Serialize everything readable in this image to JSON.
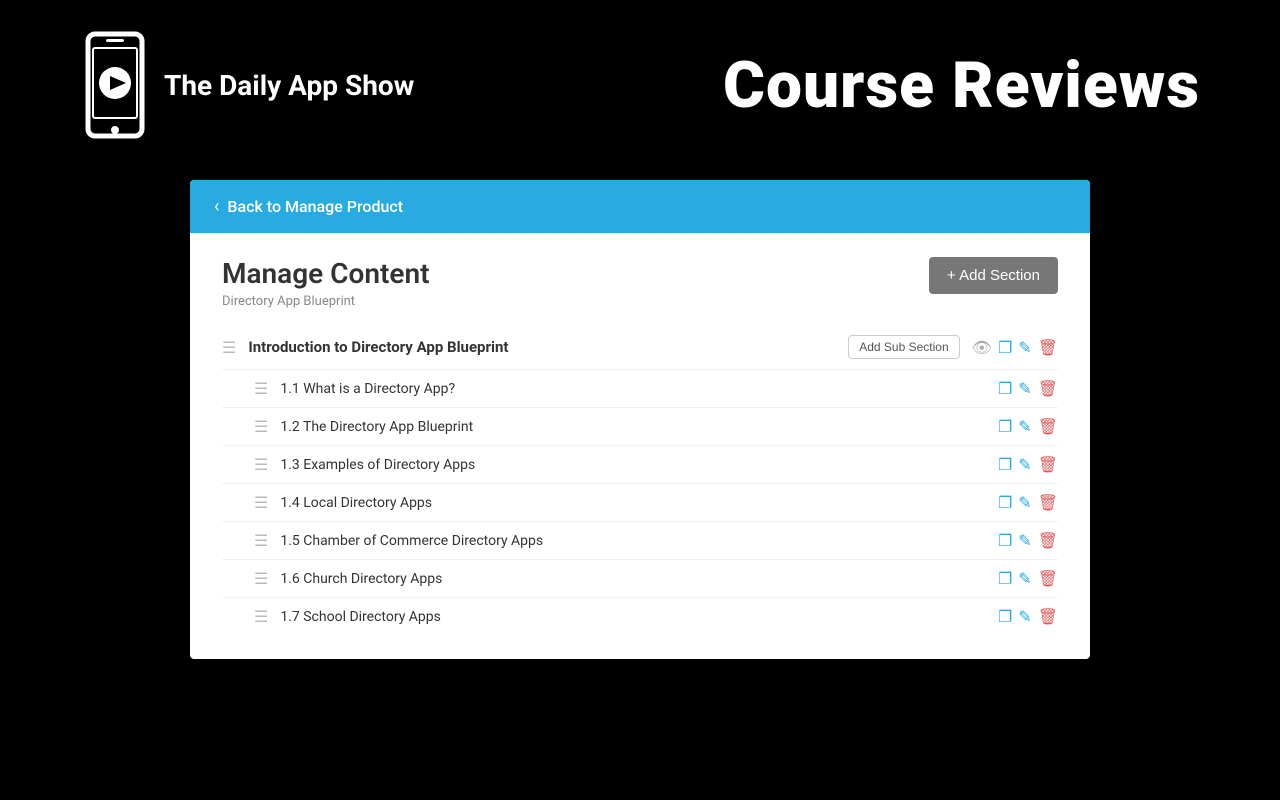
{
  "header": {
    "logo_text": "The Daily App Show",
    "page_title": "Course Reviews"
  },
  "back_nav": {
    "label": "Back to Manage Product"
  },
  "manage_content": {
    "title": "Manage Content",
    "subtitle": "Directory App Blueprint",
    "add_section_label": "+ Add Section"
  },
  "section": {
    "title": "Introduction to Directory App Blueprint",
    "add_sub_section_label": "Add Sub Section",
    "items": [
      {
        "label": "1.1 What is a Directory App?"
      },
      {
        "label": "1.2 The Directory App Blueprint"
      },
      {
        "label": "1.3 Examples of Directory Apps"
      },
      {
        "label": "1.4 Local Directory Apps"
      },
      {
        "label": "1.5 Chamber of Commerce Directory Apps"
      },
      {
        "label": "1.6 Church Directory Apps"
      },
      {
        "label": "1.7 School Directory Apps"
      }
    ]
  },
  "icons": {
    "drag": "≡",
    "copy": "❐",
    "edit": "✏",
    "delete": "🗑",
    "preview": "👁",
    "chevron_left": "‹",
    "plus": "+"
  }
}
